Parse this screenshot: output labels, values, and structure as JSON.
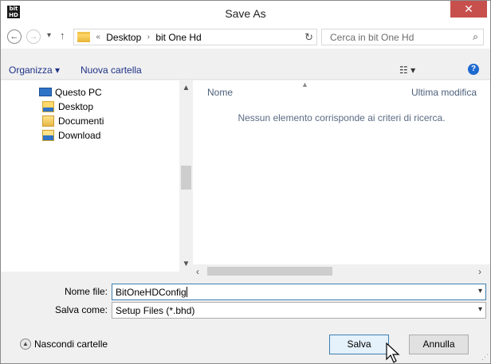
{
  "window": {
    "title": "Save As",
    "app_icon_text": "bit\nHD",
    "close_glyph": "✕"
  },
  "address": {
    "overflow": "«",
    "breadcrumb": [
      "Desktop",
      "bit One Hd"
    ],
    "separator": "›",
    "search_placeholder": "Cerca in bit One Hd"
  },
  "toolbar": {
    "organize_label": "Organizza ▾",
    "new_folder_label": "Nuova cartella",
    "view_glyph": "☷ ▾",
    "help_glyph": "?"
  },
  "nav_tree": {
    "items": [
      {
        "label": "Questo PC"
      },
      {
        "label": "Desktop"
      },
      {
        "label": "Documenti"
      },
      {
        "label": "Download"
      }
    ]
  },
  "file_list": {
    "columns": [
      "Nome",
      "Ultima modifica"
    ],
    "empty_message": "Nessun elemento corrisponde ai criteri di ricerca."
  },
  "fields": {
    "filename_label": "Nome file:",
    "filename_value": "BitOneHDConfig",
    "type_label": "Salva come:",
    "type_value": "Setup Files (*.bhd)"
  },
  "footer": {
    "hide_folders_label": "Nascondi cartelle",
    "save_label": "Salva",
    "cancel_label": "Annulla"
  },
  "colors": {
    "close_button": "#c7504d",
    "toolbar_text": "#1e3287",
    "selection": "#cce8ff"
  },
  "icons": [
    "bithd-app-icon",
    "close-icon",
    "back-arrow-icon",
    "forward-arrow-icon",
    "recent-chevron-icon",
    "up-arrow-icon",
    "folder-icon",
    "refresh-icon",
    "search-icon",
    "view-options-icon",
    "help-icon",
    "computer-icon",
    "desktop-folder-icon",
    "documents-folder-icon",
    "downloads-folder-icon",
    "chevron-down-icon",
    "mouse-cursor-icon"
  ]
}
